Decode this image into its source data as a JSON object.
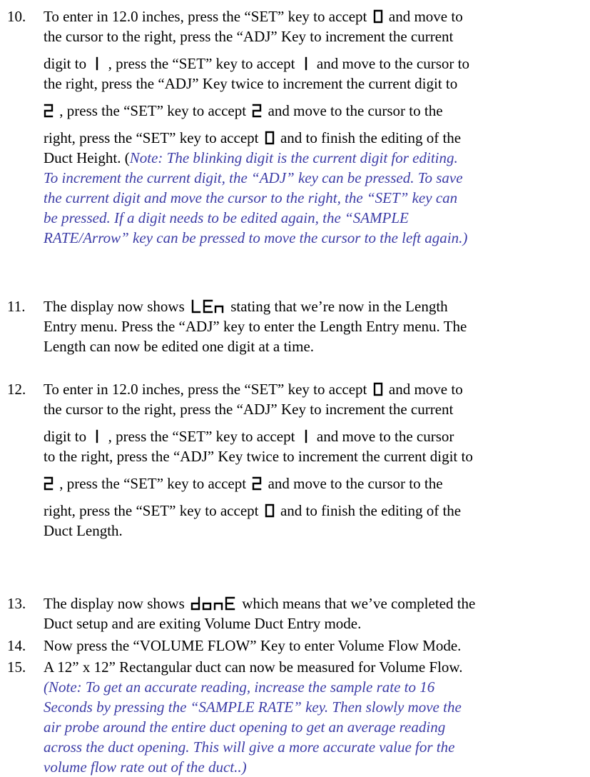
{
  "steps": [
    {
      "num": "10.",
      "l1a": "To enter in 12.0 inches, press the “SET” key to accept",
      "l1b": "and move to",
      "l2": "the cursor to the right, press the “ADJ” Key to increment the current",
      "l3a": "digit to",
      "l3b": ", press the “SET” key to accept",
      "l3c": "and move to the cursor to",
      "l4": "the right, press the “ADJ” Key twice to increment the current digit to",
      "l5a": ", press the “SET” key to accept",
      "l5b": "and move to the cursor to the",
      "l6a": "right, press the “SET” key to accept",
      "l6b": "and to finish the editing of the",
      "l7a": "Duct Height. (",
      "l7b": "Note: The blinking digit is the current digit for editing.",
      "n1": "To increment the current digit, the “ADJ” key can be pressed. To save",
      "n2": "the current digit and move the cursor to the right, the “SET” key can",
      "n3": "be pressed. If a digit needs to be edited again, the “SAMPLE",
      "n4": "RATE/Arrow” key can be pressed to move the cursor to the left again.)"
    },
    {
      "num": "11.",
      "l1a": "The display now shows",
      "l1b": "stating that we’re now in the Length",
      "l2": "Entry menu.  Press the “ADJ” key to enter the Length Entry menu. The",
      "l3": "Length can now be edited one digit at a time."
    },
    {
      "num": "12.",
      "l1a": "To enter in 12.0 inches, press the “SET” key to accept",
      "l1b": "and move to",
      "l2": "the cursor to the right, press the “ADJ” Key to increment the current",
      "l3a": "digit to",
      "l3b": ", press the “SET” key to accept",
      "l3c": "and move to the cursor",
      "l4": "to the right, press the “ADJ” Key twice to increment the current digit to",
      "l5a": ", press the “SET” key to accept",
      "l5b": "and move to the cursor to the",
      "l6a": "right, press the “SET” key to accept",
      "l6b": "and to finish the editing of the",
      "l7": "Duct Length."
    },
    {
      "num": "13.",
      "l1a": "The display now shows",
      "l1b": "which means that we’ve completed the",
      "l2": "Duct setup and are exiting Volume Duct Entry mode."
    },
    {
      "num": "14.",
      "l1": "Now press the “VOLUME FLOW” Key to enter Volume Flow Mode."
    },
    {
      "num": "15.",
      "l1": "A 12” x 12” Rectangular duct can now be measured for Volume Flow.",
      "n1": "(Note: To get an accurate reading, increase the sample rate to 16",
      "n2": "Seconds by pressing the “SAMPLE RATE” key. Then slowly move the",
      "n3": "air probe around the entire duct opening to get an average reading",
      "n4": "across the duct opening. This will give a more accurate value for the",
      "n5": "volume flow rate out of the duct..)"
    }
  ],
  "display_words": {
    "zero": "0",
    "one": "1",
    "two": "2",
    "len": "LEn",
    "done": "donE"
  }
}
